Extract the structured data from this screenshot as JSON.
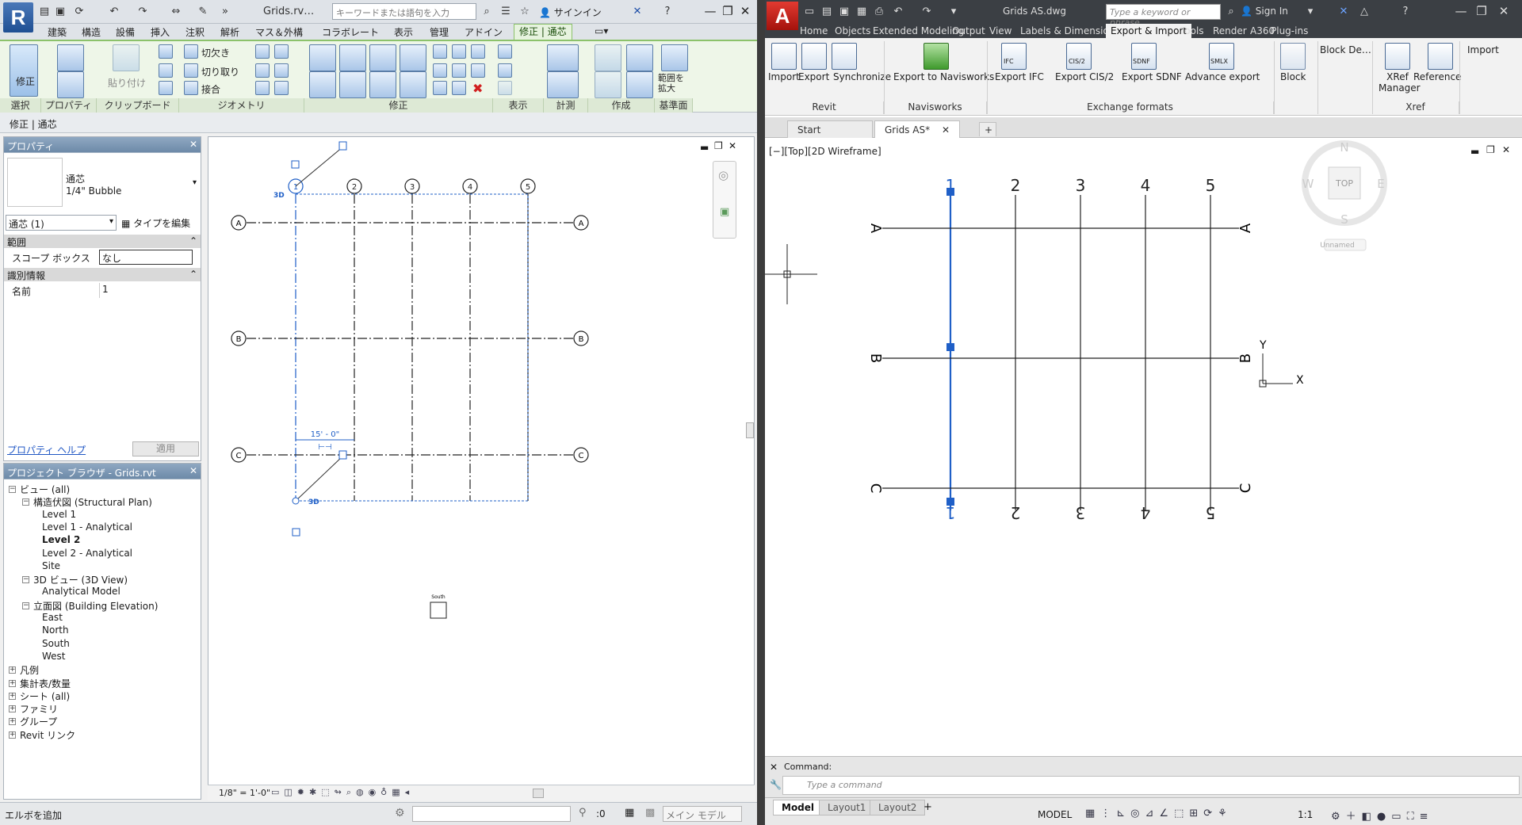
{
  "revit": {
    "logo": "R",
    "doc_title": "Grids.rv…",
    "search_placeholder": "キーワードまたは語句を入力",
    "signin": "サインイン",
    "tabs": [
      "建築",
      "構造",
      "設備",
      "挿入",
      "注釈",
      "解析",
      "マス＆外構",
      "コラボレート",
      "表示",
      "管理",
      "アドイン",
      "修正 | 通芯"
    ],
    "active_tab": "修正 | 通芯",
    "ribbon": {
      "modify_label": "修正",
      "paste_label": "貼り付け",
      "cut_label": "切欠き",
      "cut2_label": "切り取り",
      "join_label": "接合",
      "extend_label": "範囲を\n拡大",
      "panels": [
        "選択",
        "プロパティ",
        "クリップボード",
        "ジオメトリ",
        "修正",
        "表示",
        "計測",
        "作成",
        "基準面"
      ]
    },
    "context_bar": "修正 | 通芯",
    "properties": {
      "header": "プロパティ",
      "type_family": "通芯",
      "type_name": "1/4\" Bubble",
      "selector": "通芯 (1)",
      "edit_type": "タイプを編集",
      "section_extents": "範囲",
      "scope_box_label": "スコープ ボックス",
      "scope_box_value": "なし",
      "section_identity": "識別情報",
      "name_label": "名前",
      "name_value": "1",
      "help_link": "プロパティ ヘルプ",
      "apply": "適用"
    },
    "browser": {
      "header": "プロジェクト ブラウザ - Grids.rvt",
      "items": [
        {
          "label": "ビュー (all)",
          "level": 0,
          "bold": false
        },
        {
          "label": "構造伏図 (Structural Plan)",
          "level": 1,
          "bold": false
        },
        {
          "label": "Level 1",
          "level": 2,
          "bold": false
        },
        {
          "label": "Level 1 - Analytical",
          "level": 2,
          "bold": false
        },
        {
          "label": "Level 2",
          "level": 2,
          "bold": true
        },
        {
          "label": "Level 2 - Analytical",
          "level": 2,
          "bold": false
        },
        {
          "label": "Site",
          "level": 2,
          "bold": false
        },
        {
          "label": "3D ビュー (3D View)",
          "level": 1,
          "bold": false
        },
        {
          "label": "Analytical Model",
          "level": 2,
          "bold": false
        },
        {
          "label": "立面図 (Building Elevation)",
          "level": 1,
          "bold": false
        },
        {
          "label": "East",
          "level": 2,
          "bold": false
        },
        {
          "label": "North",
          "level": 2,
          "bold": false
        },
        {
          "label": "South",
          "level": 2,
          "bold": false
        },
        {
          "label": "West",
          "level": 2,
          "bold": false
        },
        {
          "label": "凡例",
          "level": 0,
          "bold": false
        },
        {
          "label": "集計表/数量",
          "level": 0,
          "bold": false
        },
        {
          "label": "シート (all)",
          "level": 0,
          "bold": false
        },
        {
          "label": "ファミリ",
          "level": 0,
          "bold": false
        },
        {
          "label": "グループ",
          "level": 0,
          "bold": false
        },
        {
          "label": "Revit リンク",
          "level": 0,
          "bold": false
        }
      ]
    },
    "view": {
      "grid_numbers": [
        "1",
        "2",
        "3",
        "4",
        "5"
      ],
      "grid_letters": [
        "A",
        "B",
        "C"
      ],
      "dim_text": "15' - 0\"",
      "tag_3d": "3D",
      "elev_label": "South",
      "scale": "1/8\" = 1'-0\""
    },
    "status": {
      "left": "エルボを追加",
      "filter_count": ":0",
      "model": "メイン モデル"
    }
  },
  "autocad": {
    "logo": "A",
    "doc_title": "Grids AS.dwg",
    "search_placeholder": "Type a keyword or phrase",
    "signin": "Sign In",
    "tabs": [
      "Home",
      "Objects",
      "Extended Modeling",
      "Output",
      "View",
      "Labels & Dimensions",
      "Export & Import",
      "Tools",
      "Render",
      "A360",
      "Plug-ins"
    ],
    "active_tab": "Export & Import",
    "ribbon": {
      "buttons": [
        "Import",
        "Export",
        "Synchronize",
        "Export to Navisworks",
        "Export IFC",
        "Export CIS/2",
        "Export SDNF",
        "Advance export",
        "Block",
        "Block De…",
        "XRef Manager",
        "Reference",
        "Import"
      ],
      "icon_tags": [
        "IFC",
        "CIS/2",
        "SDNF",
        "SMLX"
      ],
      "panels": [
        "Revit",
        "Navisworks",
        "Exchange formats",
        "Xref"
      ]
    },
    "file_tabs": [
      "Start",
      "Grids AS*"
    ],
    "viewport_label": "[−][Top][2D Wireframe]",
    "viewcube": {
      "n": "N",
      "s": "S",
      "e": "E",
      "w": "W",
      "top": "TOP",
      "ucs": "Unnamed"
    },
    "grid_numbers": [
      "1",
      "2",
      "3",
      "4",
      "5"
    ],
    "grid_letters": [
      "A",
      "B",
      "C"
    ],
    "axis_x": "X",
    "axis_y": "Y",
    "command_label": "Command:",
    "command_placeholder": "Type a command",
    "layout_tabs": [
      "Model",
      "Layout1",
      "Layout2"
    ],
    "status_model": "MODEL",
    "scale": "1:1"
  },
  "colors": {
    "revit_accent": "#8cc26b",
    "selection_blue": "#1f5fc7",
    "autocad_dark": "#3b3f44"
  }
}
